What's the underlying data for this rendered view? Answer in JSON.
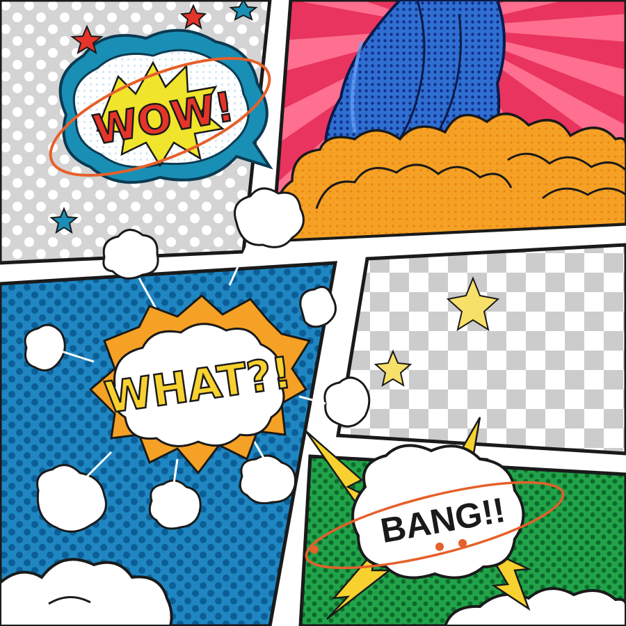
{
  "comic": {
    "wow": {
      "text": "WOW!"
    },
    "what": {
      "text": "WHAT?!"
    },
    "bang": {
      "text": "BANG!!"
    }
  },
  "colors": {
    "gray_panel": "#d4d4d4",
    "gray_dots": "#ffffff",
    "pink_panel": "#e8345f",
    "pink_rays": "#ff6f8f",
    "blue_panel": "#1f86c2",
    "blue_dots": "#0b5f96",
    "green_panel": "#22a34a",
    "green_dots": "#0b6b2c",
    "checker_light": "#ffffff",
    "checker_dark": "#cccccc",
    "orange_cloud": "#f5a125",
    "yellow": "#f7d12f",
    "red_text": "#e5342a",
    "bubble_teal": "#1a8fb5",
    "outline": "#1a1a1a"
  },
  "icons": [
    "star-icon",
    "smoke-puff-icon",
    "explosion-icon",
    "lightning-icon",
    "cloud-icon",
    "rocket-icon"
  ]
}
